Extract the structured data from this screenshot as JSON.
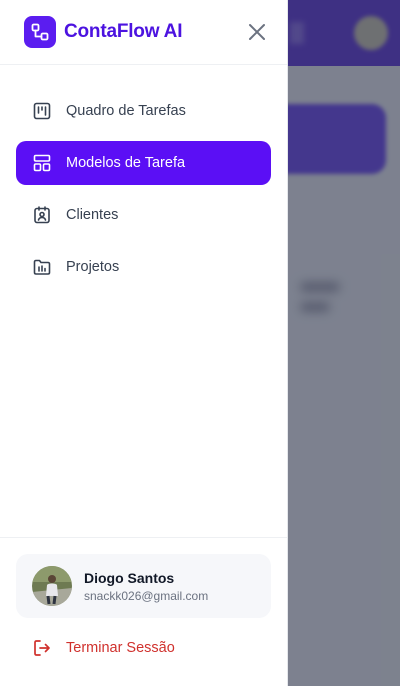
{
  "app": {
    "name": "ContaFlow AI",
    "brand_color": "#5b1df0"
  },
  "nav": {
    "items": [
      {
        "label": "Quadro de Tarefas",
        "icon": "kanban-board-icon",
        "active": false
      },
      {
        "label": "Modelos de Tarefa",
        "icon": "template-layout-icon",
        "active": true
      },
      {
        "label": "Clientes",
        "icon": "contact-card-icon",
        "active": false
      },
      {
        "label": "Projetos",
        "icon": "folder-chart-icon",
        "active": false
      }
    ]
  },
  "user": {
    "name": "Diogo Santos",
    "email": "snackk026@gmail.com"
  },
  "logout": {
    "label": "Terminar Sessão",
    "icon": "logout-icon",
    "color": "#d0312d"
  },
  "colors": {
    "active_bg": "#5b0ff5",
    "accent": "#4c13e0"
  }
}
